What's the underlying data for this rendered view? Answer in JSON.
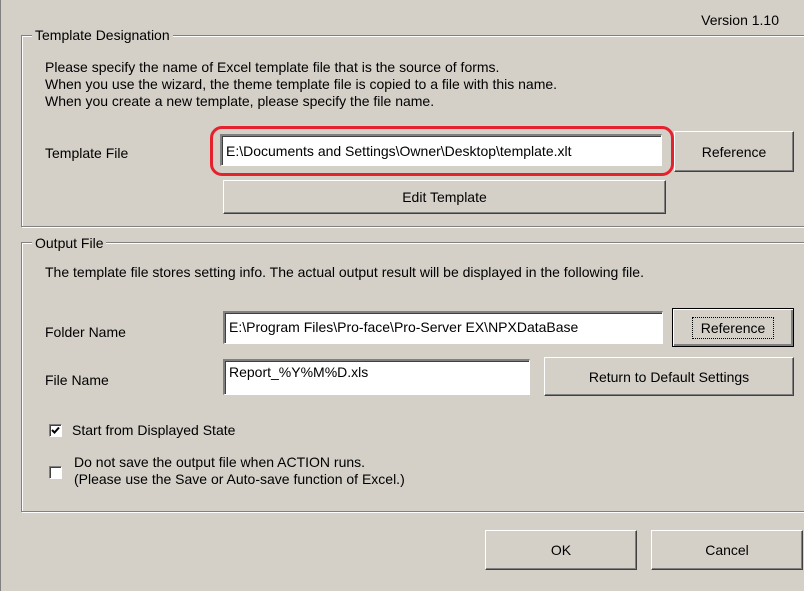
{
  "version": "Version 1.10",
  "template_group": {
    "title": "Template Designation",
    "desc_lines": [
      "Please specify the name of Excel template file that is the source of forms.",
      "When you use the wizard, the theme template file is copied to a file with this name.",
      "When you create a new template, please specify the file name."
    ],
    "template_file_label": "Template File",
    "template_file_value": "E:\\Documents and Settings\\Owner\\Desktop\\template.xlt",
    "reference_label": "Reference",
    "edit_template_label": "Edit Template"
  },
  "output_group": {
    "title": "Output File",
    "desc": "The template file stores setting info. The actual output result will be displayed in the following file.",
    "folder_label": "Folder Name",
    "folder_value": "E:\\Program Files\\Pro-face\\Pro-Server EX\\NPXDataBase",
    "reference_label": "Reference",
    "file_label": "File Name",
    "file_value": "Report_%Y%M%D.xls",
    "default_label": "Return to Default Settings",
    "start_label": "Start from Displayed State",
    "start_checked": true,
    "nosave_line1": "Do not save the output file when ACTION runs.",
    "nosave_line2": "(Please use the Save or Auto-save function of Excel.)",
    "nosave_checked": false
  },
  "buttons": {
    "ok": "OK",
    "cancel": "Cancel"
  },
  "colors": {
    "highlight": "#e4212c",
    "dialog_bg": "#d4d0c8"
  }
}
